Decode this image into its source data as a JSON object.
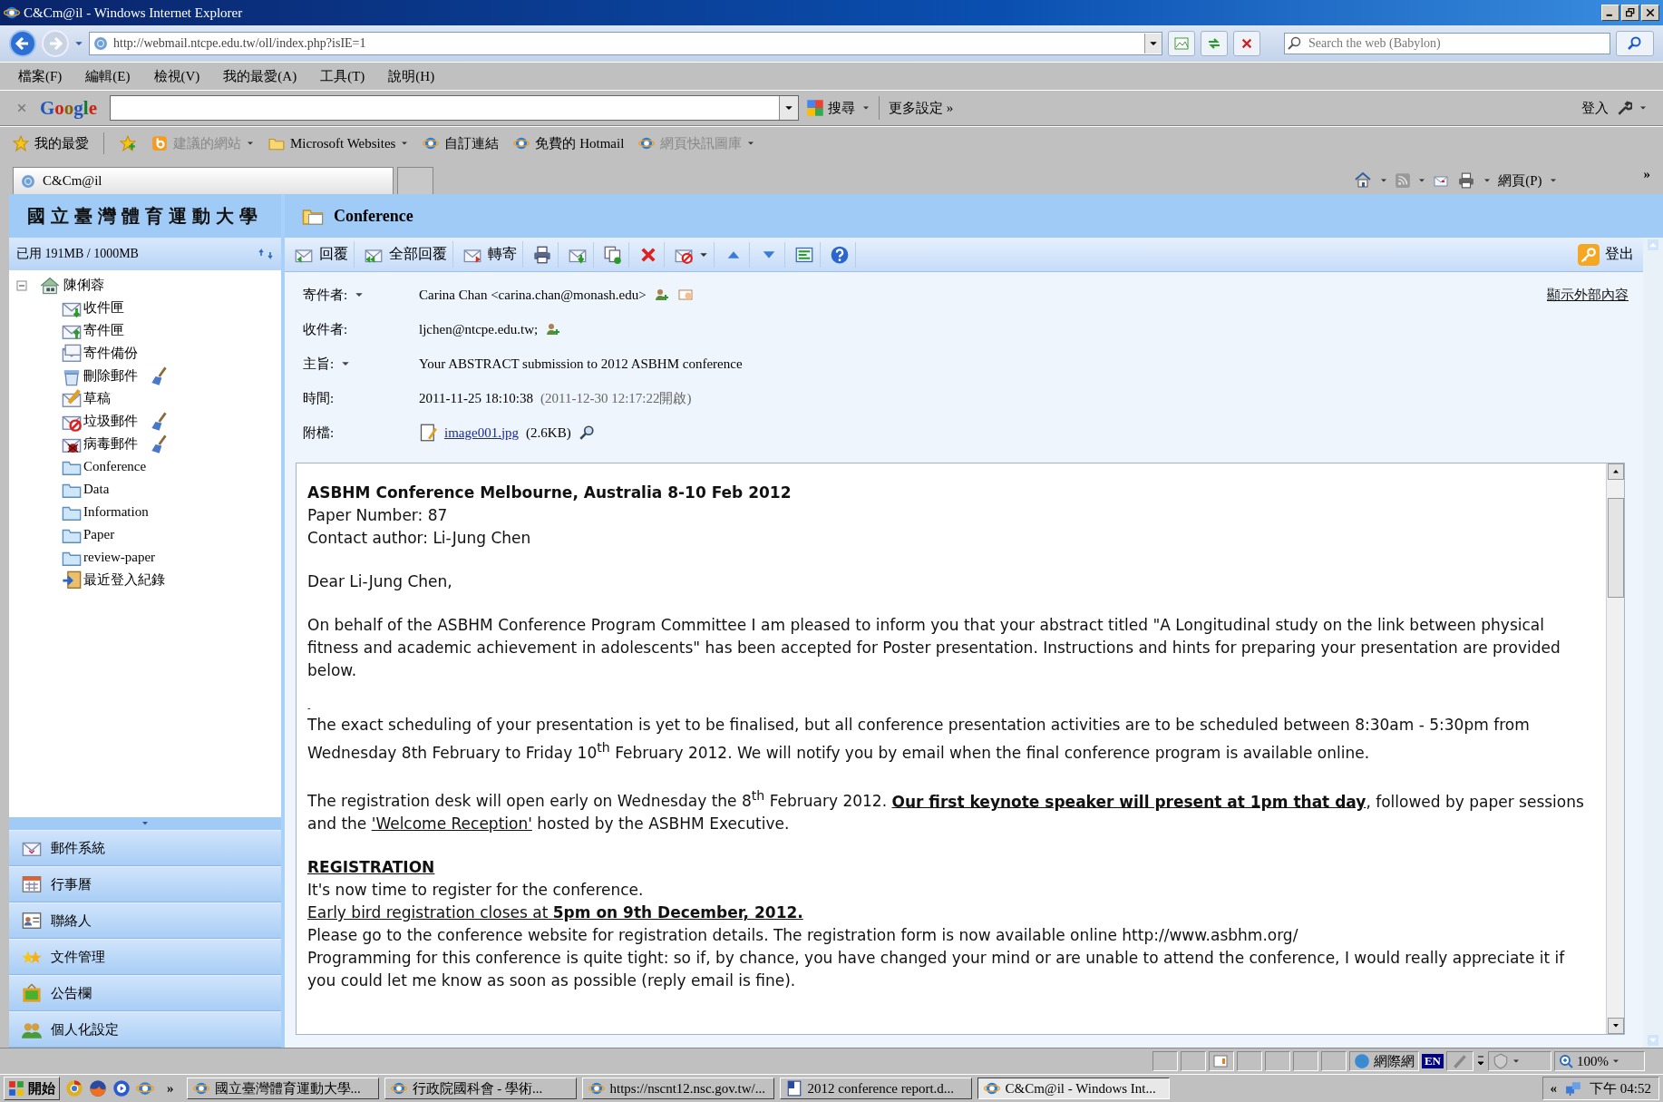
{
  "window": {
    "title": "C&Cm@il - Windows Internet Explorer"
  },
  "address_bar": {
    "url": "http://webmail.ntcpe.edu.tw/oll/index.php?isIE=1",
    "search_placeholder": "Search the web (Babylon)"
  },
  "menu": [
    "檔案(F)",
    "編輯(E)",
    "檢視(V)",
    "我的最愛(A)",
    "工具(T)",
    "說明(H)"
  ],
  "google_bar": {
    "logo": "Google",
    "search": "搜尋",
    "more": "更多設定 »",
    "sign_in": "登入"
  },
  "favorites": [
    {
      "kind": "favorites",
      "label": "我的最愛",
      "disabled": false
    },
    {
      "kind": "suggested",
      "label": "建議的網站",
      "disabled": true
    },
    {
      "kind": "folder",
      "label": "Microsoft Websites",
      "disabled": false
    },
    {
      "kind": "page",
      "label": "自訂連結",
      "disabled": false
    },
    {
      "kind": "page",
      "label": "免費的 Hotmail",
      "disabled": false
    },
    {
      "kind": "page",
      "label": "網頁快訊圖庫",
      "disabled": true
    }
  ],
  "tabs": [
    {
      "label": "C&Cm@il",
      "selected": true
    }
  ],
  "command_bar": {
    "page": "網頁(P)",
    "overflow": "»"
  },
  "app": {
    "school": "國立臺灣體育運動大學",
    "quota": "已用 191MB / 1000MB",
    "folder_title": "Conference",
    "logout": "登出",
    "show_external": "顯示外部內容"
  },
  "toolbar": [
    {
      "kind": "reply",
      "label": "回覆"
    },
    {
      "kind": "reply-all",
      "label": "全部回覆"
    },
    {
      "kind": "forward",
      "label": "轉寄"
    },
    {
      "kind": "print"
    },
    {
      "kind": "move"
    },
    {
      "kind": "copy"
    },
    {
      "kind": "delete"
    },
    {
      "kind": "block"
    },
    {
      "kind": "previous"
    },
    {
      "kind": "next"
    },
    {
      "kind": "filter"
    },
    {
      "kind": "help"
    }
  ],
  "tree": {
    "label": "陳俐蓉",
    "expanded": true,
    "children": [
      {
        "kind": "inbox",
        "label": "收件匣",
        "clean": false
      },
      {
        "kind": "sent",
        "label": "寄件匣",
        "clean": false
      },
      {
        "kind": "backup",
        "label": "寄件備份",
        "clean": false
      },
      {
        "kind": "trash",
        "label": "刪除郵件",
        "clean": true
      },
      {
        "kind": "drafts",
        "label": "草稿",
        "clean": false
      },
      {
        "kind": "spam",
        "label": "垃圾郵件",
        "clean": true
      },
      {
        "kind": "virus",
        "label": "病毒郵件",
        "clean": true
      },
      {
        "kind": "folder",
        "label": "Conference",
        "clean": false
      },
      {
        "kind": "folder",
        "label": "Data",
        "clean": false
      },
      {
        "kind": "folder",
        "label": "Information",
        "clean": false
      },
      {
        "kind": "folder",
        "label": "Paper",
        "clean": false
      },
      {
        "kind": "folder",
        "label": "review-paper",
        "clean": false
      },
      {
        "kind": "log",
        "label": "最近登入紀錄",
        "clean": false
      }
    ]
  },
  "modules": [
    {
      "kind": "mail",
      "label": "郵件系統"
    },
    {
      "kind": "calendar",
      "label": "行事曆"
    },
    {
      "kind": "contacts",
      "label": "聯絡人"
    },
    {
      "kind": "documents",
      "label": "文件管理"
    },
    {
      "kind": "board",
      "label": "公告欄"
    },
    {
      "kind": "settings",
      "label": "個人化設定"
    }
  ],
  "headers": [
    {
      "kind": "from",
      "label": "寄件者:",
      "value": "Carina Chan <carina.chan@monash.edu>"
    },
    {
      "kind": "to",
      "label": "收件者:",
      "value": "ljchen@ntcpe.edu.tw;"
    },
    {
      "kind": "subject",
      "label": "主旨:",
      "value": "Your ABSTRACT submission to 2012 ASBHM conference"
    },
    {
      "kind": "time",
      "label": "時間:",
      "value": "2011-11-25 18:10:38",
      "note": "(2011-12-30 12:17:22開啟)"
    },
    {
      "kind": "attachment",
      "label": "附檔:",
      "value": "image001.jpg",
      "note": "(2.6KB)"
    }
  ],
  "message_body": [
    [
      {
        "kind": "title",
        "text": "ASBHM Conference Melbourne, Australia 8-10 Feb 2012"
      },
      {
        "kind": "line",
        "text": "Paper Number: 87"
      },
      {
        "kind": "line",
        "text": "Contact author: Li-Jung Chen"
      }
    ],
    [
      {
        "kind": "line",
        "text": "Dear Li-Jung Chen,"
      }
    ],
    [
      {
        "kind": "line",
        "text": "On behalf of the ASBHM Conference Program Committee I am pleased to inform you that your abstract titled \"A Longitudinal study on the link between physical fitness and academic achievement in adolescents\" has been accepted for Poster presentation.  Instructions and hints for preparing your presentation are provided below."
      }
    ],
    [
      {
        "kind": "mark",
        "text": "-"
      },
      {
        "kind": "line",
        "text": "The exact scheduling of your presentation is yet to be finalised, but all conference presentation activities are to be scheduled between 8:30am - 5:30pm from Wednesday 8th February to Friday 10$^{th}$ February 2012. We will notify you by email when the final conference program is available online."
      }
    ],
    [
      {
        "kind": "runs",
        "runs": [
          {
            "kind": "text",
            "text": "The registration desk will open early on Wednesday the 8$^{th}$ February 2012. "
          },
          {
            "kind": "link",
            "text": "Our first keynote speaker will present at 1pm that day"
          },
          {
            "kind": "text",
            "text": ", followed by paper sessions and the "
          },
          {
            "kind": "link",
            "text": "'Welcome Reception'"
          },
          {
            "kind": "text",
            "text": " hosted by the ASBHM Executive."
          }
        ]
      }
    ],
    [
      {
        "kind": "heading",
        "text": "REGISTRATION"
      },
      {
        "kind": "line",
        "text": "It's now time to register for the conference."
      },
      {
        "kind": "underlined",
        "text": "Early bird registration closes at **5pm on 9th December, 2012.**"
      },
      {
        "kind": "line",
        "text": "Please go to the conference website for registration details. The registration form is now available online http://www.asbhm.org/"
      },
      {
        "kind": "line",
        "text": "Programming for this conference is quite tight: so if, by chance, you have changed your mind or are unable to attend the conference, I would really appreciate it if you could let me know as soon as possible (reply email is fine)."
      }
    ]
  ],
  "status_bar": {
    "zone": "網際網",
    "language": "EN",
    "zoom": "100%"
  },
  "taskbar": {
    "start": "開始",
    "more": "»",
    "tasks": [
      {
        "label": "國立臺灣體育運動大學...",
        "kind": "browser",
        "selected": false
      },
      {
        "label": "行政院國科會 - 學術...",
        "kind": "browser",
        "selected": false
      },
      {
        "label": "https://nscnt12.nsc.gov.tw/...",
        "kind": "browser",
        "selected": false
      },
      {
        "label": "2012 conference report.d...",
        "kind": "document",
        "selected": false
      },
      {
        "label": "C&Cm@il - Windows Int...",
        "kind": "browser",
        "selected": true
      }
    ],
    "tray_toggle": "«",
    "clock": "下午 04:52"
  }
}
